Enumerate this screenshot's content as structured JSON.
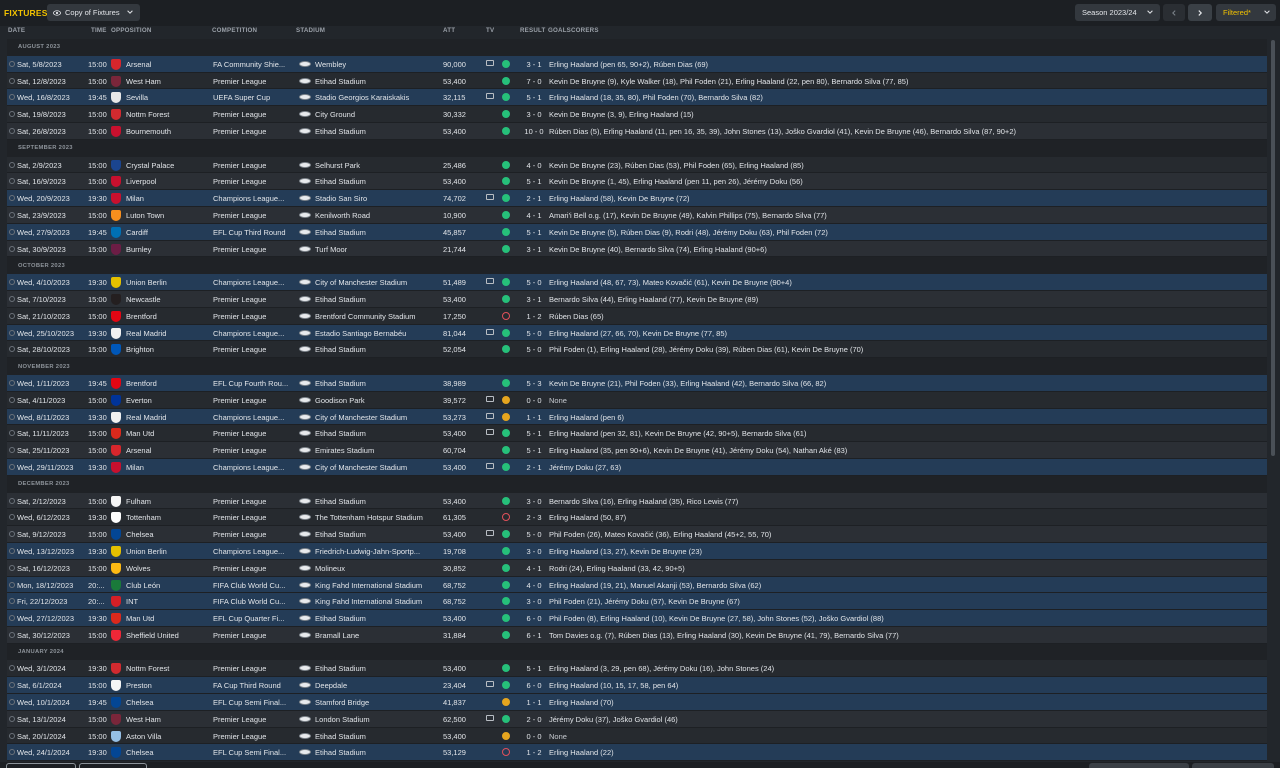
{
  "header": {
    "title": "FIXTURES",
    "view_label": "Copy of Fixtures",
    "season_label": "Season 2023/24",
    "filter_label": "Filtered*"
  },
  "columns": {
    "date": "DATE",
    "time": "TIME",
    "opposition": "OPPOSITION",
    "competition": "COMPETITION",
    "stadium": "STADIUM",
    "att": "ATT",
    "tv": "TV",
    "result": "RESULT",
    "goalscorers": "GOALSCORERS"
  },
  "colors": {
    "accent": "#f2c200",
    "win": "#26c07a",
    "draw": "#e5a51f",
    "loss": "#e0505a",
    "highlight_row": "#243c57"
  },
  "months": [
    {
      "label": "AUGUST 2023",
      "fixtures": [
        {
          "date": "Sat, 5/8/2023",
          "time": "15:00",
          "opp": "Arsenal",
          "crest": "#d6262c",
          "comp": "FA Community Shie...",
          "stadium": "Wembley",
          "att": "90,000",
          "tv": true,
          "res": "w",
          "score": "3 - 1",
          "goals": "Erling Haaland (pen 65, 90+2), Rúben Dias (69)",
          "hl": true
        },
        {
          "date": "Sat, 12/8/2023",
          "time": "15:00",
          "opp": "West Ham",
          "crest": "#7a263a",
          "comp": "Premier League",
          "stadium": "Etihad Stadium",
          "att": "53,400",
          "tv": false,
          "res": "w",
          "score": "7 - 0",
          "goals": "Kevin De Bruyne (9), Kyle Walker (18), Phil Foden (21), Erling Haaland (22, pen 80), Bernardo Silva (77, 85)",
          "hl": false
        },
        {
          "date": "Wed, 16/8/2023",
          "time": "19:45",
          "opp": "Sevilla",
          "crest": "#e8e8e8",
          "comp": "UEFA Super Cup",
          "stadium": "Stadio Georgios Karaiskakis",
          "att": "32,115",
          "tv": true,
          "res": "w",
          "score": "5 - 1",
          "goals": "Erling Haaland (18, 35, 80), Phil Foden (70), Bernardo Silva (82)",
          "hl": true
        },
        {
          "date": "Sat, 19/8/2023",
          "time": "15:00",
          "opp": "Nottm Forest",
          "crest": "#d12a2f",
          "comp": "Premier League",
          "stadium": "City Ground",
          "att": "30,332",
          "tv": false,
          "res": "w",
          "score": "3 - 0",
          "goals": "Kevin De Bruyne (3, 9), Erling Haaland (15)",
          "hl": false
        },
        {
          "date": "Sat, 26/8/2023",
          "time": "15:00",
          "opp": "Bournemouth",
          "crest": "#c8102e",
          "comp": "Premier League",
          "stadium": "Etihad Stadium",
          "att": "53,400",
          "tv": false,
          "res": "w",
          "score": "10 - 0",
          "goals": "Rúben Dias (5), Erling Haaland (11, pen 16, 35, 39), John Stones (13), Joško Gvardiol (41), Kevin De Bruyne (46), Bernardo Silva (87, 90+2)",
          "hl": false
        }
      ]
    },
    {
      "label": "SEPTEMBER 2023",
      "fixtures": [
        {
          "date": "Sat, 2/9/2023",
          "time": "15:00",
          "opp": "Crystal Palace",
          "crest": "#1b458f",
          "comp": "Premier League",
          "stadium": "Selhurst Park",
          "att": "25,486",
          "tv": false,
          "res": "w",
          "score": "4 - 0",
          "goals": "Kevin De Bruyne (23), Rúben Dias (53), Phil Foden (65), Erling Haaland (85)",
          "hl": false
        },
        {
          "date": "Sat, 16/9/2023",
          "time": "15:00",
          "opp": "Liverpool",
          "crest": "#c8102e",
          "comp": "Premier League",
          "stadium": "Etihad Stadium",
          "att": "53,400",
          "tv": false,
          "res": "w",
          "score": "5 - 1",
          "goals": "Kevin De Bruyne (1, 45), Erling Haaland (pen 11, pen 26), Jérémy Doku (56)",
          "hl": false
        },
        {
          "date": "Wed, 20/9/2023",
          "time": "19:30",
          "opp": "Milan",
          "crest": "#c8102e",
          "comp": "Champions League...",
          "stadium": "Stadio San Siro",
          "att": "74,702",
          "tv": true,
          "res": "w",
          "score": "2 - 1",
          "goals": "Erling Haaland (58), Kevin De Bruyne (72)",
          "hl": true
        },
        {
          "date": "Sat, 23/9/2023",
          "time": "15:00",
          "opp": "Luton Town",
          "crest": "#f78f1e",
          "comp": "Premier League",
          "stadium": "Kenilworth Road",
          "att": "10,900",
          "tv": false,
          "res": "w",
          "score": "4 - 1",
          "goals": "Amari'i Bell o.g. (17), Kevin De Bruyne (49), Kalvin Phillips (75), Bernardo Silva (77)",
          "hl": false
        },
        {
          "date": "Wed, 27/9/2023",
          "time": "19:45",
          "opp": "Cardiff",
          "crest": "#0070b5",
          "comp": "EFL Cup Third Round",
          "stadium": "Etihad Stadium",
          "att": "45,857",
          "tv": false,
          "res": "w",
          "score": "5 - 1",
          "goals": "Kevin De Bruyne (5), Rúben Dias (9), Rodri (48), Jérémy Doku (63), Phil Foden (72)",
          "hl": true
        },
        {
          "date": "Sat, 30/9/2023",
          "time": "15:00",
          "opp": "Burnley",
          "crest": "#6c1d45",
          "comp": "Premier League",
          "stadium": "Turf Moor",
          "att": "21,744",
          "tv": false,
          "res": "w",
          "score": "3 - 1",
          "goals": "Kevin De Bruyne (40), Bernardo Silva (74), Erling Haaland (90+6)",
          "hl": false
        }
      ]
    },
    {
      "label": "OCTOBER 2023",
      "fixtures": [
        {
          "date": "Wed, 4/10/2023",
          "time": "19:30",
          "opp": "Union Berlin",
          "crest": "#e4c000",
          "comp": "Champions League...",
          "stadium": "City of Manchester Stadium",
          "att": "51,489",
          "tv": true,
          "res": "w",
          "score": "5 - 0",
          "goals": "Erling Haaland (48, 67, 73), Mateo Kovačić (61), Kevin De Bruyne (90+4)",
          "hl": true
        },
        {
          "date": "Sat, 7/10/2023",
          "time": "15:00",
          "opp": "Newcastle",
          "crest": "#241f20",
          "comp": "Premier League",
          "stadium": "Etihad Stadium",
          "att": "53,400",
          "tv": false,
          "res": "w",
          "score": "3 - 1",
          "goals": "Bernardo Silva (44), Erling Haaland (77), Kevin De Bruyne (89)",
          "hl": false
        },
        {
          "date": "Sat, 21/10/2023",
          "time": "15:00",
          "opp": "Brentford",
          "crest": "#e30613",
          "comp": "Premier League",
          "stadium": "Brentford Community Stadium",
          "att": "17,250",
          "tv": false,
          "res": "l",
          "score": "1 - 2",
          "goals": "Rúben Dias (65)",
          "hl": false
        },
        {
          "date": "Wed, 25/10/2023",
          "time": "19:30",
          "opp": "Real Madrid",
          "crest": "#f1f1f1",
          "comp": "Champions League...",
          "stadium": "Estadio Santiago Bernabéu",
          "att": "81,044",
          "tv": true,
          "res": "w",
          "score": "5 - 0",
          "goals": "Erling Haaland (27, 66, 70), Kevin De Bruyne (77, 85)",
          "hl": true
        },
        {
          "date": "Sat, 28/10/2023",
          "time": "15:00",
          "opp": "Brighton",
          "crest": "#0057b8",
          "comp": "Premier League",
          "stadium": "Etihad Stadium",
          "att": "52,054",
          "tv": false,
          "res": "w",
          "score": "5 - 0",
          "goals": "Phil Foden (1), Erling Haaland (28), Jérémy Doku (39), Rúben Dias (61), Kevin De Bruyne (70)",
          "hl": false
        }
      ]
    },
    {
      "label": "NOVEMBER 2023",
      "fixtures": [
        {
          "date": "Wed, 1/11/2023",
          "time": "19:45",
          "opp": "Brentford",
          "crest": "#e30613",
          "comp": "EFL Cup Fourth Rou...",
          "stadium": "Etihad Stadium",
          "att": "38,989",
          "tv": false,
          "res": "w",
          "score": "5 - 3",
          "goals": "Kevin De Bruyne (21), Phil Foden (33), Erling Haaland (42), Bernardo Silva (66, 82)",
          "hl": true
        },
        {
          "date": "Sat, 4/11/2023",
          "time": "15:00",
          "opp": "Everton",
          "crest": "#003399",
          "comp": "Premier League",
          "stadium": "Goodison Park",
          "att": "39,572",
          "tv": true,
          "res": "d",
          "score": "0 - 0",
          "goals": "None",
          "hl": false
        },
        {
          "date": "Wed, 8/11/2023",
          "time": "19:30",
          "opp": "Real Madrid",
          "crest": "#f1f1f1",
          "comp": "Champions League...",
          "stadium": "City of Manchester Stadium",
          "att": "53,273",
          "tv": true,
          "res": "d",
          "score": "1 - 1",
          "goals": "Erling Haaland (pen 6)",
          "hl": true
        },
        {
          "date": "Sat, 11/11/2023",
          "time": "15:00",
          "opp": "Man Utd",
          "crest": "#da291c",
          "comp": "Premier League",
          "stadium": "Etihad Stadium",
          "att": "53,400",
          "tv": true,
          "res": "w",
          "score": "5 - 1",
          "goals": "Erling Haaland (pen 32, 81), Kevin De Bruyne (42, 90+5), Bernardo Silva (61)",
          "hl": false
        },
        {
          "date": "Sat, 25/11/2023",
          "time": "15:00",
          "opp": "Arsenal",
          "crest": "#d6262c",
          "comp": "Premier League",
          "stadium": "Emirates Stadium",
          "att": "60,704",
          "tv": false,
          "res": "w",
          "score": "5 - 1",
          "goals": "Erling Haaland (35, pen 90+6), Kevin De Bruyne (41), Jérémy Doku (54), Nathan Aké (83)",
          "hl": false
        },
        {
          "date": "Wed, 29/11/2023",
          "time": "19:30",
          "opp": "Milan",
          "crest": "#c8102e",
          "comp": "Champions League...",
          "stadium": "City of Manchester Stadium",
          "att": "53,400",
          "tv": true,
          "res": "w",
          "score": "2 - 1",
          "goals": "Jérémy Doku (27, 63)",
          "hl": true
        }
      ]
    },
    {
      "label": "DECEMBER 2023",
      "fixtures": [
        {
          "date": "Sat, 2/12/2023",
          "time": "15:00",
          "opp": "Fulham",
          "crest": "#f5f5f5",
          "comp": "Premier League",
          "stadium": "Etihad Stadium",
          "att": "53,400",
          "tv": false,
          "res": "w",
          "score": "3 - 0",
          "goals": "Bernardo Silva (16), Erling Haaland (35), Rico Lewis (77)",
          "hl": false
        },
        {
          "date": "Wed, 6/12/2023",
          "time": "19:30",
          "opp": "Tottenham",
          "crest": "#ffffff",
          "comp": "Premier League",
          "stadium": "The Tottenham Hotspur Stadium",
          "att": "61,305",
          "tv": false,
          "res": "l",
          "score": "2 - 3",
          "goals": "Erling Haaland (50, 87)",
          "hl": false
        },
        {
          "date": "Sat, 9/12/2023",
          "time": "15:00",
          "opp": "Chelsea",
          "crest": "#034694",
          "comp": "Premier League",
          "stadium": "Etihad Stadium",
          "att": "53,400",
          "tv": true,
          "res": "w",
          "score": "5 - 0",
          "goals": "Phil Foden (26), Mateo Kovačić (36), Erling Haaland (45+2, 55, 70)",
          "hl": false
        },
        {
          "date": "Wed, 13/12/2023",
          "time": "19:30",
          "opp": "Union Berlin",
          "crest": "#e4c000",
          "comp": "Champions League...",
          "stadium": "Friedrich-Ludwig-Jahn-Sportp...",
          "att": "19,708",
          "tv": false,
          "res": "w",
          "score": "3 - 0",
          "goals": "Erling Haaland (13, 27), Kevin De Bruyne (23)",
          "hl": true
        },
        {
          "date": "Sat, 16/12/2023",
          "time": "15:00",
          "opp": "Wolves",
          "crest": "#fdb913",
          "comp": "Premier League",
          "stadium": "Molineux",
          "att": "30,852",
          "tv": false,
          "res": "w",
          "score": "4 - 1",
          "goals": "Rodri (24), Erling Haaland (33, 42, 90+5)",
          "hl": false
        },
        {
          "date": "Mon, 18/12/2023",
          "time": "20:...",
          "opp": "Club León",
          "crest": "#1a7a3a",
          "comp": "FIFA Club World Cu...",
          "stadium": "King Fahd International Stadium",
          "att": "68,752",
          "tv": false,
          "res": "w",
          "score": "4 - 0",
          "goals": "Erling Haaland (19, 21), Manuel Akanji (53), Bernardo Silva (62)",
          "hl": true
        },
        {
          "date": "Fri, 22/12/2023",
          "time": "20:...",
          "opp": "INT",
          "crest": "#d41f26",
          "comp": "FIFA Club World Cu...",
          "stadium": "King Fahd International Stadium",
          "att": "68,752",
          "tv": false,
          "res": "w",
          "score": "3 - 0",
          "goals": "Phil Foden (21), Jérémy Doku (57), Kevin De Bruyne (67)",
          "hl": true
        },
        {
          "date": "Wed, 27/12/2023",
          "time": "19:30",
          "opp": "Man Utd",
          "crest": "#da291c",
          "comp": "EFL Cup Quarter Fi...",
          "stadium": "Etihad Stadium",
          "att": "53,400",
          "tv": false,
          "res": "w",
          "score": "6 - 0",
          "goals": "Phil Foden (8), Erling Haaland (10), Kevin De Bruyne (27, 58), John Stones (52), Joško Gvardiol (88)",
          "hl": true
        },
        {
          "date": "Sat, 30/12/2023",
          "time": "15:00",
          "opp": "Sheffield United",
          "crest": "#ee2737",
          "comp": "Premier League",
          "stadium": "Bramall Lane",
          "att": "31,884",
          "tv": false,
          "res": "w",
          "score": "6 - 1",
          "goals": "Tom Davies o.g. (7), Rúben Dias (13), Erling Haaland (30), Kevin De Bruyne (41, 79), Bernardo Silva (77)",
          "hl": false
        }
      ]
    },
    {
      "label": "JANUARY 2024",
      "fixtures": [
        {
          "date": "Wed, 3/1/2024",
          "time": "19:30",
          "opp": "Nottm Forest",
          "crest": "#d12a2f",
          "comp": "Premier League",
          "stadium": "Etihad Stadium",
          "att": "53,400",
          "tv": false,
          "res": "w",
          "score": "5 - 1",
          "goals": "Erling Haaland (3, 29, pen 68), Jérémy Doku (16), John Stones (24)",
          "hl": false
        },
        {
          "date": "Sat, 6/1/2024",
          "time": "15:00",
          "opp": "Preston",
          "crest": "#f5f5f5",
          "comp": "FA Cup Third Round",
          "stadium": "Deepdale",
          "att": "23,404",
          "tv": true,
          "res": "w",
          "score": "6 - 0",
          "goals": "Erling Haaland (10, 15, 17, 58, pen 64)",
          "hl": true
        },
        {
          "date": "Wed, 10/1/2024",
          "time": "19:45",
          "opp": "Chelsea",
          "crest": "#034694",
          "comp": "EFL Cup Semi Final...",
          "stadium": "Stamford Bridge",
          "att": "41,837",
          "tv": false,
          "res": "d",
          "score": "1 - 1",
          "goals": "Erling Haaland (70)",
          "hl": true
        },
        {
          "date": "Sat, 13/1/2024",
          "time": "15:00",
          "opp": "West Ham",
          "crest": "#7a263a",
          "comp": "Premier League",
          "stadium": "London Stadium",
          "att": "62,500",
          "tv": true,
          "res": "w",
          "score": "2 - 0",
          "goals": "Jérémy Doku (37), Joško Gvardiol (46)",
          "hl": false
        },
        {
          "date": "Sat, 20/1/2024",
          "time": "15:00",
          "opp": "Aston Villa",
          "crest": "#95bfe5",
          "comp": "Premier League",
          "stadium": "Etihad Stadium",
          "att": "53,400",
          "tv": false,
          "res": "d",
          "score": "0 - 0",
          "goals": "None",
          "hl": false
        },
        {
          "date": "Wed, 24/1/2024",
          "time": "19:30",
          "opp": "Chelsea",
          "crest": "#034694",
          "comp": "EFL Cup Semi Final...",
          "stadium": "Etihad Stadium",
          "att": "53,129",
          "tv": false,
          "res": "l",
          "score": "1 - 2",
          "goals": "Erling Haaland (22)",
          "hl": true
        }
      ]
    }
  ]
}
